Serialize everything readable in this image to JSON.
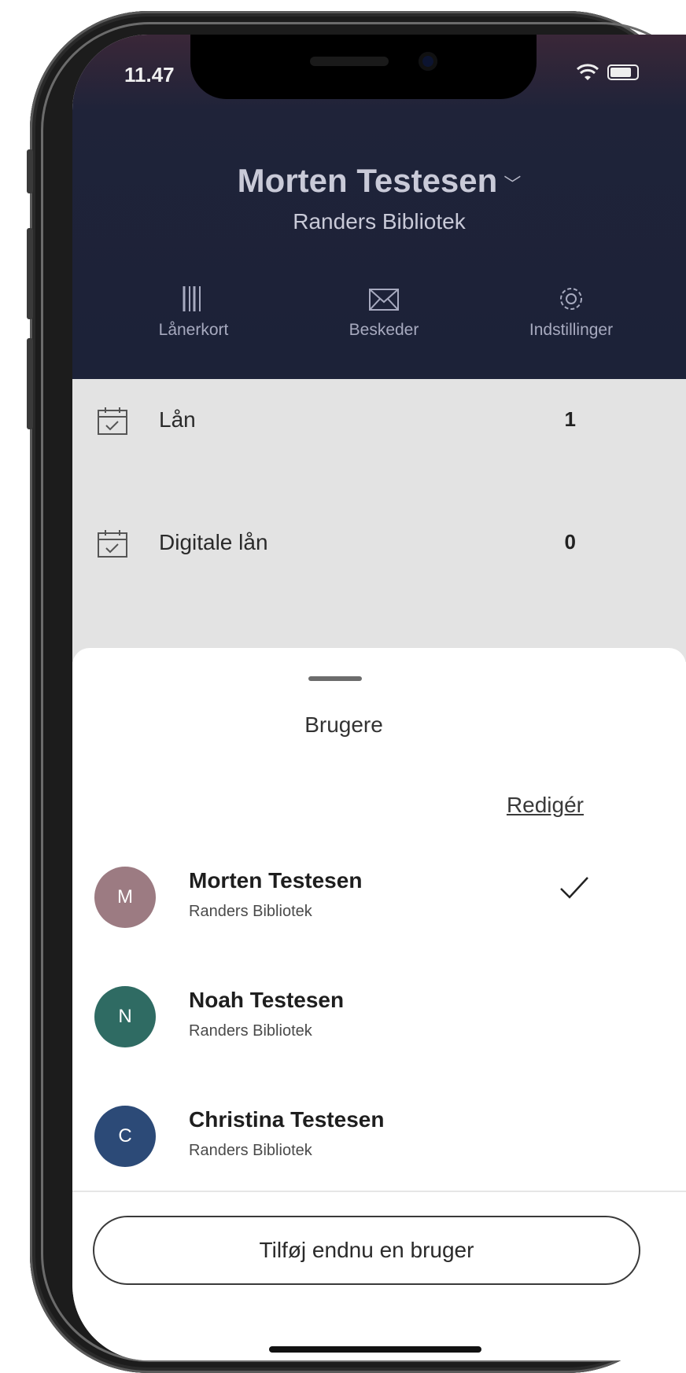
{
  "status_bar": {
    "time": "11.47"
  },
  "header": {
    "user_name": "Morten Testesen",
    "library": "Randers Bibliotek",
    "nav": [
      {
        "label": "Lånerkort",
        "icon": "barcode-icon"
      },
      {
        "label": "Beskeder",
        "icon": "envelope-icon"
      },
      {
        "label": "Indstillinger",
        "icon": "gear-icon"
      }
    ]
  },
  "loans": [
    {
      "label": "Lån",
      "count": "1",
      "icon": "calendar-check-icon"
    },
    {
      "label": "Digitale lån",
      "count": "0",
      "icon": "calendar-check-icon"
    }
  ],
  "sheet": {
    "title": "Brugere",
    "edit_label": "Redigér",
    "users": [
      {
        "initial": "M",
        "name": "Morten Testesen",
        "library": "Randers Bibliotek",
        "color": "#9c7b82",
        "selected": true
      },
      {
        "initial": "N",
        "name": "Noah Testesen",
        "library": "Randers Bibliotek",
        "color": "#2f6b63",
        "selected": false
      },
      {
        "initial": "C",
        "name": "Christina Testesen",
        "library": "Randers Bibliotek",
        "color": "#2c4a77",
        "selected": false
      }
    ],
    "add_user_label": "Tilføj endnu en bruger"
  },
  "colors": {
    "header_bg": "#1c2238",
    "loans_bg": "#e3e3e3",
    "avatar_m": "#9c7b82",
    "avatar_n": "#2f6b63",
    "avatar_c": "#2c4a77"
  }
}
